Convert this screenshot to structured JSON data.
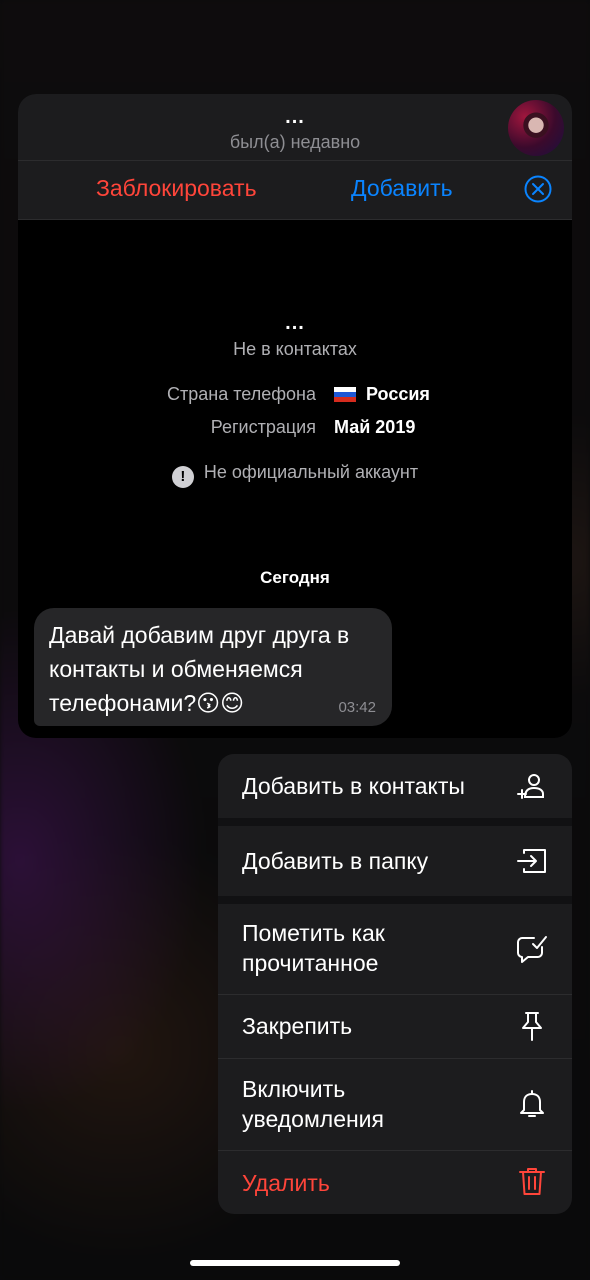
{
  "chat_preview": {
    "header": {
      "name": "...",
      "status": "был(а) недавно"
    },
    "actions": {
      "block_label": "Заблокировать",
      "add_label": "Добавить"
    },
    "profile_info": {
      "name": "...",
      "subtitle": "Не в контактах",
      "country_key": "Страна телефона",
      "country_value": "Россия",
      "registration_key": "Регистрация",
      "registration_value": "Май 2019",
      "warning": "Не официальный аккаунт"
    },
    "date_divider": "Сегодня",
    "message": {
      "text": "Давай добавим друг друга в контакты и обменяемся телефонами?😗😊",
      "time": "03:42"
    }
  },
  "context_menu": {
    "items": [
      {
        "label": "Добавить в контакты",
        "icon": "add-contact-icon"
      },
      {
        "label": "Добавить в папку",
        "icon": "folder-add-icon"
      },
      {
        "label": "Пометить как прочитанное",
        "icon": "mark-read-icon"
      },
      {
        "label": "Закрепить",
        "icon": "pin-icon"
      },
      {
        "label": "Включить уведомления",
        "icon": "bell-icon"
      },
      {
        "label": "Удалить",
        "icon": "trash-icon"
      }
    ]
  },
  "colors": {
    "destructive": "#ff453a",
    "accent": "#0a84ff",
    "surface": "#1c1c1e"
  }
}
